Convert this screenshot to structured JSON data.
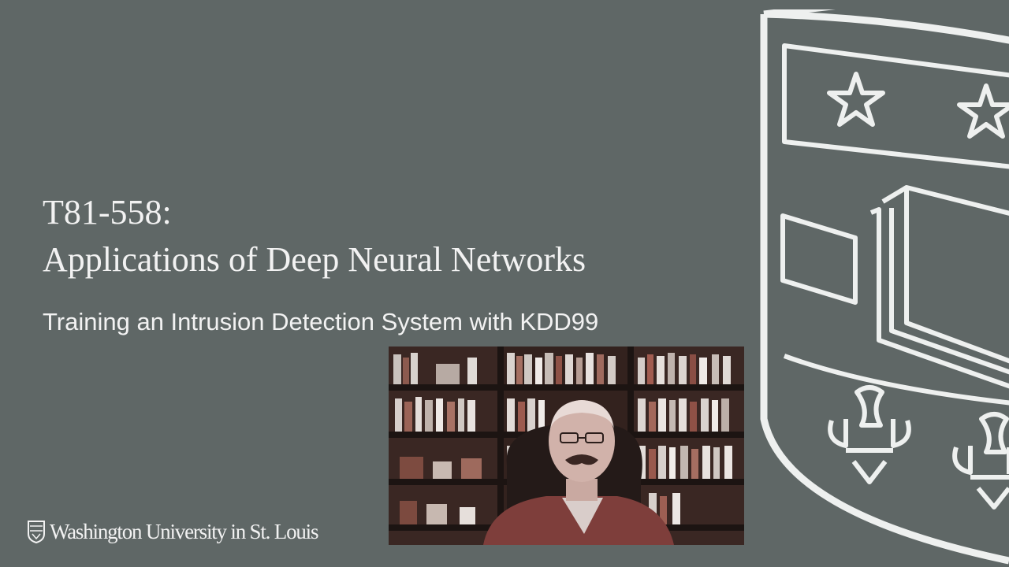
{
  "slide": {
    "course_code": "T81-558:",
    "course_title": "Applications of Deep Neural Networks",
    "lecture_subtitle": "Training an Intrusion Detection System with KDD99"
  },
  "footer": {
    "university_name": "Washington University in St. Louis",
    "seal_icon": "university-seal-icon"
  },
  "decor": {
    "background_shield_icon": "shield-crest-icon",
    "webcam_feed": "presenter-webcam-video"
  },
  "colors": {
    "background": "#5f6766",
    "text": "#f2f2f2",
    "shield_outline": "#eef0ef"
  }
}
